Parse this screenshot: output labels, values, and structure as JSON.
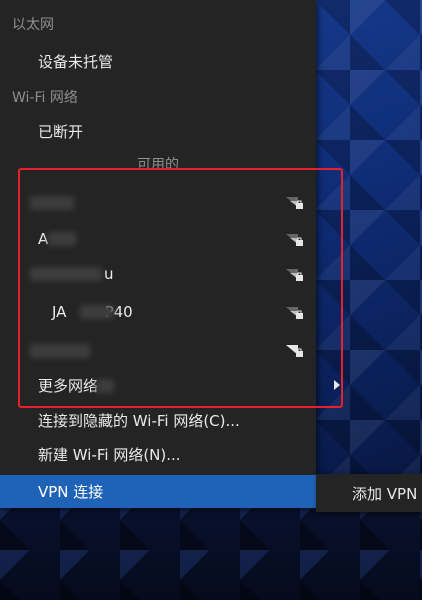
{
  "ethernet": {
    "header": "以太网",
    "status": "设备未托管"
  },
  "wifi": {
    "header": "Wi-Fi 网络",
    "status": "已断开",
    "available_label": "可用的",
    "networks": [
      {
        "ssid": ""
      },
      {
        "ssid": "A"
      },
      {
        "ssid": "u"
      },
      {
        "ssid": "JA        P40"
      },
      {
        "ssid": ""
      }
    ],
    "more_networks": "更多网络"
  },
  "actions": {
    "hidden_network": "连接到隐藏的 Wi-Fi 网络(C)...",
    "new_network": "新建 Wi-Fi 网络(N)...",
    "vpn": "VPN 连接"
  },
  "submenu": {
    "add_vpn": "添加 VPN"
  },
  "colors": {
    "accent": "#1f63b8",
    "highlight_box": "#e8202a",
    "menu_bg": "#242424"
  },
  "icons": {
    "wifi": "wifi-signal-lock-icon",
    "arrow": "chevron-right-icon"
  }
}
